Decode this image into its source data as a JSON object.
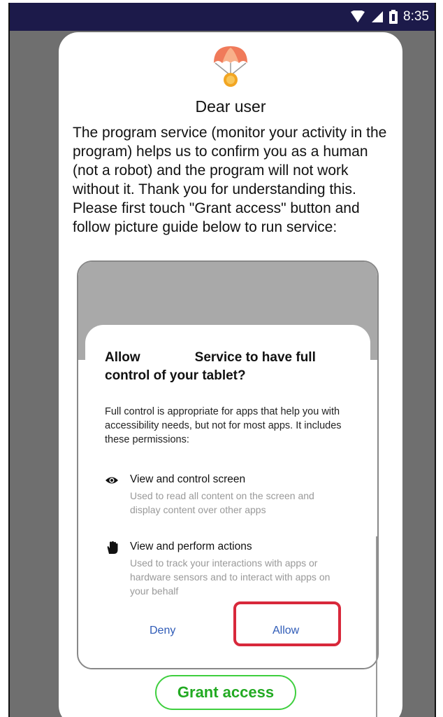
{
  "status_bar": {
    "time": "8:35",
    "icons": [
      "wifi-icon",
      "signal-icon",
      "battery-icon"
    ],
    "background": "#1c1a4a"
  },
  "dialog": {
    "title": "Dear user",
    "paragraph1": "The program service (monitor your activity in the program) helps us to confirm you as a human (not a robot) and the program will not work without it. Thank you for understanding this.",
    "paragraph2": "Please first touch \"Grant access\" button and follow picture guide below to run service:",
    "grant_button": "Grant access",
    "grant_color": "#3fcf3f"
  },
  "guide": {
    "title_part1": "Allow",
    "title_part2": "Service to have full control of your tablet?",
    "description": "Full control is appropriate for apps that help you with accessibility needs, but not for most apps. It includes these permissions:",
    "permissions": [
      {
        "icon": "eye-icon",
        "title": "View and control screen",
        "subtitle": "Used to read all content on the screen and display content over other apps"
      },
      {
        "icon": "hand-icon",
        "title": "View and perform actions",
        "subtitle": "Used to track your interactions with apps or hardware sensors and to interact with apps on your behalf"
      }
    ],
    "deny_label": "Deny",
    "allow_label": "Allow",
    "highlight_color": "#d8283b",
    "button_color": "#2f5bb7"
  }
}
